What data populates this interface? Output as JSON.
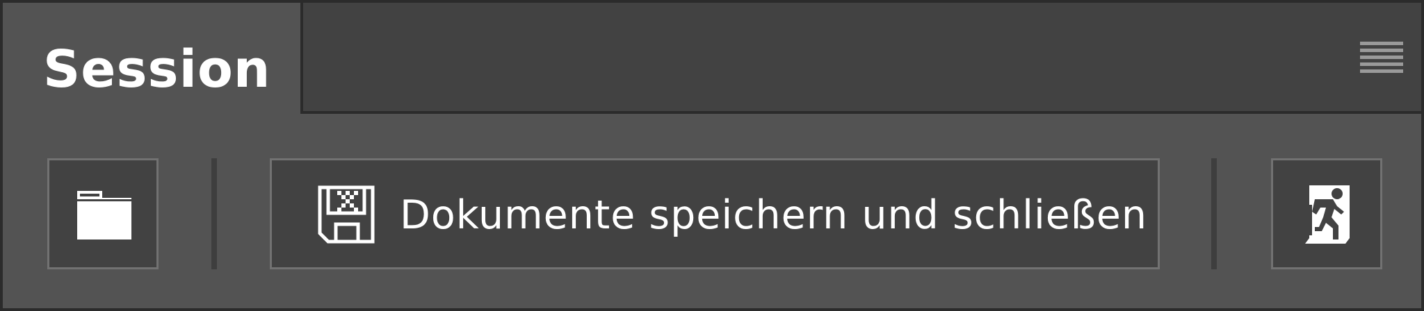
{
  "panel": {
    "tab_title": "Session",
    "menu_icon": "hamburger-menu-icon"
  },
  "toolbar": {
    "open_button": {
      "icon": "folder-icon"
    },
    "save_close_button": {
      "icon": "floppy-disk-icon",
      "label": "Dokumente speichern und schließen"
    },
    "exit_button": {
      "icon": "emergency-exit-icon"
    }
  },
  "colors": {
    "panel_bg": "#535353",
    "tab_bar_bg": "#424242",
    "button_bg": "#424242",
    "button_border": "#727272",
    "text": "#ffffff"
  }
}
